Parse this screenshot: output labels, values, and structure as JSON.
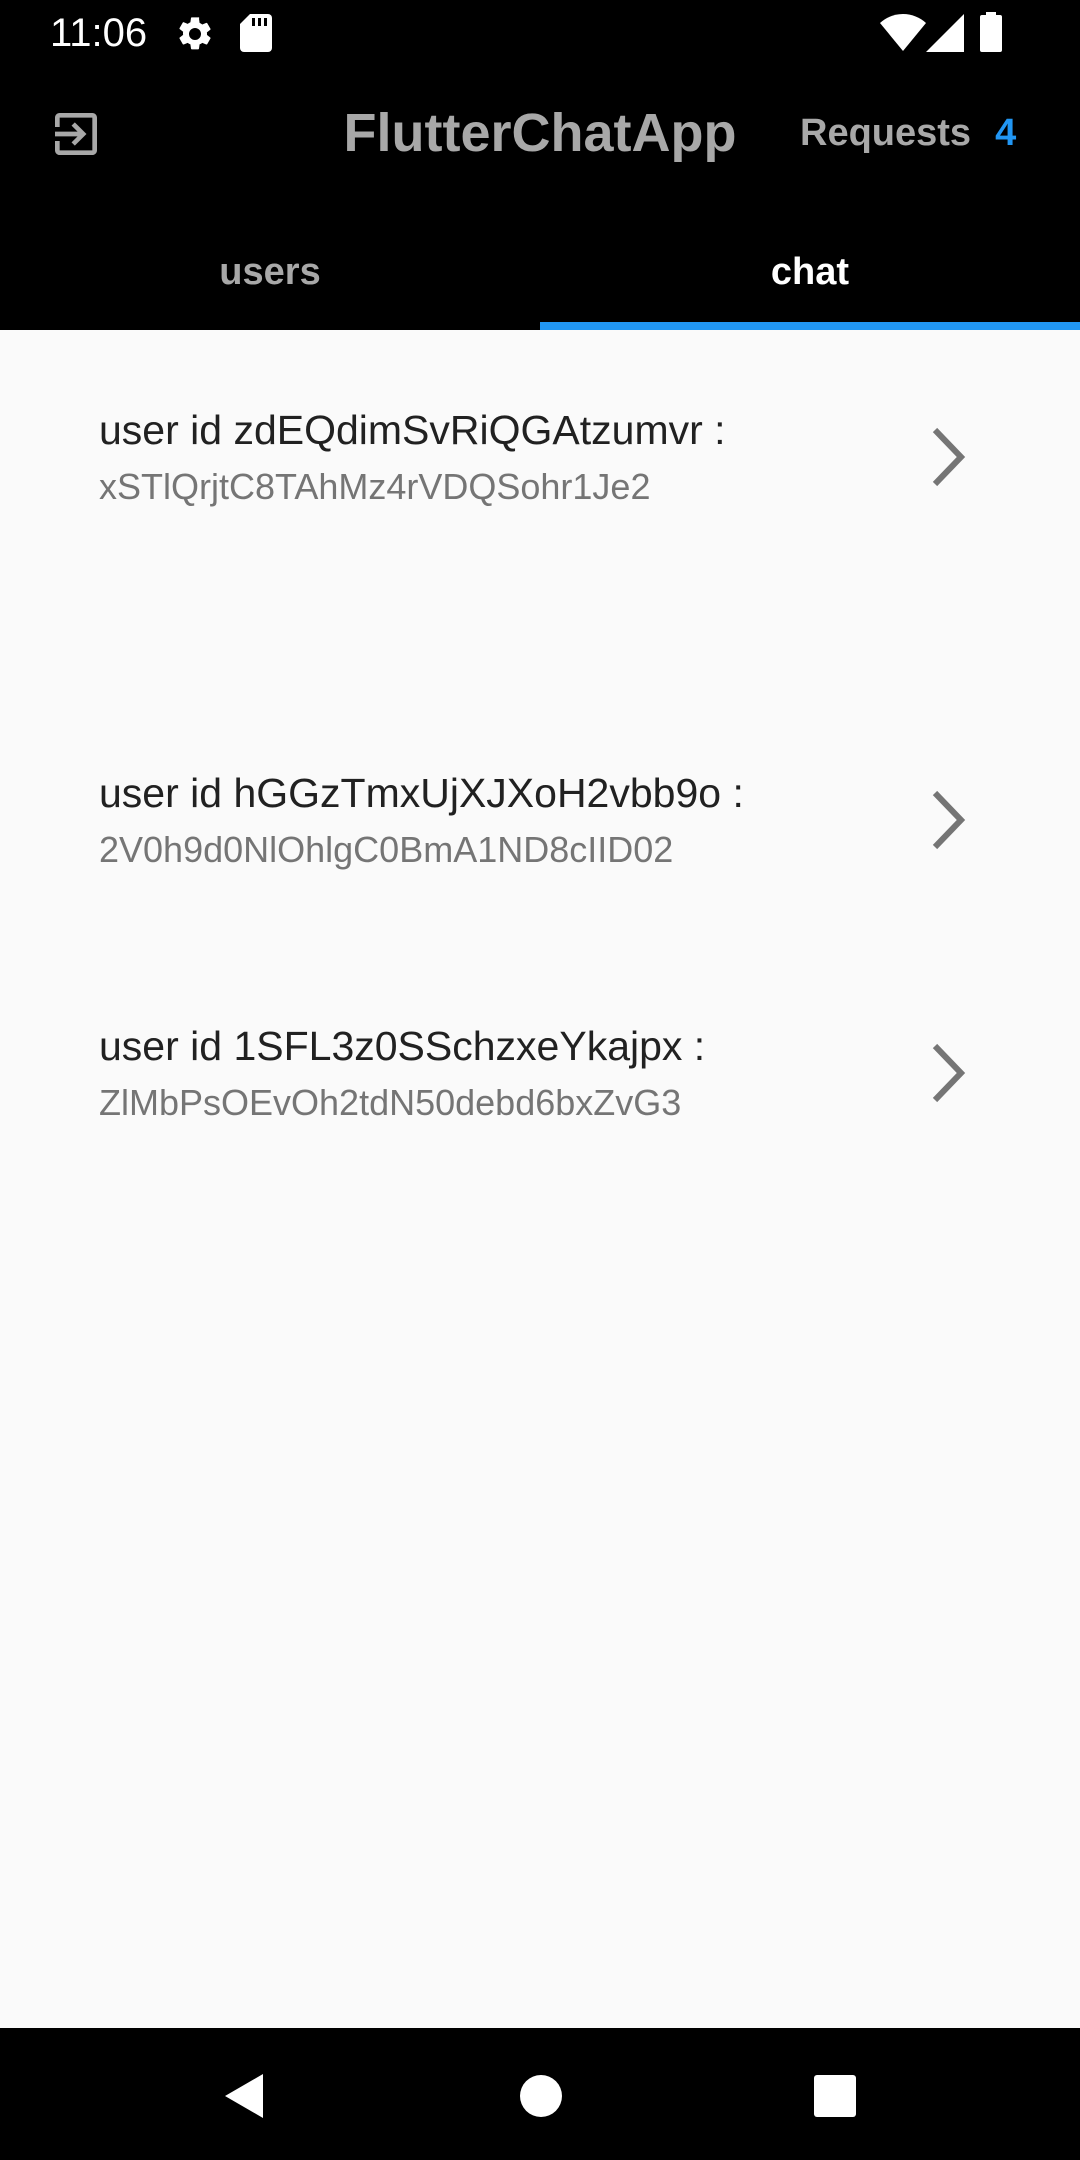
{
  "status_bar": {
    "time": "11:06"
  },
  "app_bar": {
    "title": "FlutterChatApp",
    "requests_label": "Requests",
    "requests_count": "4",
    "logout_icon": "logout-icon"
  },
  "tabs": [
    {
      "label": "users",
      "selected": false
    },
    {
      "label": "chat",
      "selected": true
    }
  ],
  "chats": [
    {
      "title": "user id zdEQdimSvRiQGAtzumvr :",
      "subtitle": "xSTlQrjtC8TAhMz4rVDQSohr1Je2"
    },
    {
      "title": "user id hGGzTmxUjXJXoH2vbb9o :",
      "subtitle": "2V0h9d0NlOhlgC0BmA1ND8cIID02"
    },
    {
      "title": "user id 1SFL3z0SSchzxeYkajpx :",
      "subtitle": "ZlMbPsOEvOh2tdN50debd6bxZvG3"
    }
  ],
  "colors": {
    "accent": "#2196f3",
    "app_bar_bg": "#000000",
    "page_bg": "#fafafa",
    "muted_text": "#a8a8a8"
  }
}
